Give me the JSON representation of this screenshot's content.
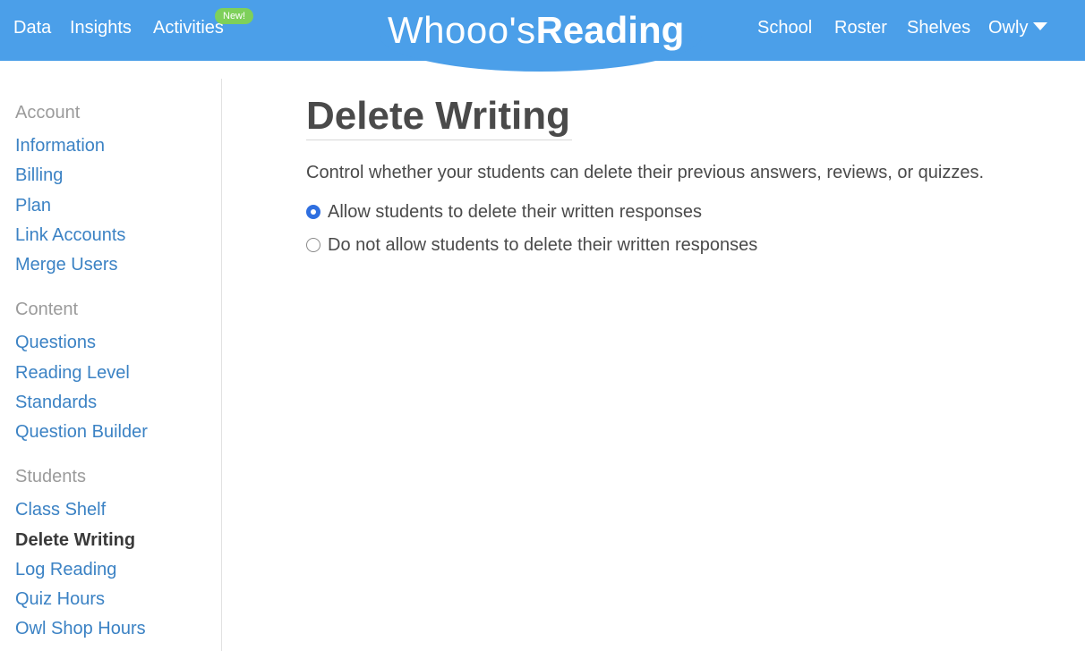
{
  "header": {
    "left_nav": [
      "Data",
      "Insights",
      "Activities"
    ],
    "new_badge": "New!",
    "logo": {
      "light": "Whooo's",
      "bold": "Reading"
    },
    "right_nav": [
      "School",
      "Roster",
      "Shelves"
    ],
    "user_menu": "Owly"
  },
  "sidebar": {
    "sections": [
      {
        "heading": "Account",
        "items": [
          "Information",
          "Billing",
          "Plan",
          "Link Accounts",
          "Merge Users"
        ]
      },
      {
        "heading": "Content",
        "items": [
          "Questions",
          "Reading Level",
          "Standards",
          "Question Builder"
        ]
      },
      {
        "heading": "Students",
        "items": [
          "Class Shelf",
          "Delete Writing",
          "Log Reading",
          "Quiz Hours",
          "Owl Shop Hours"
        ]
      }
    ],
    "active_item": "Delete Writing"
  },
  "main": {
    "title": "Delete Writing",
    "description": "Control whether your students can delete their previous answers, reviews, or quizzes.",
    "options": [
      {
        "label": "Allow students to delete their written responses",
        "selected": true
      },
      {
        "label": "Do not allow students to delete their written responses",
        "selected": false
      }
    ]
  },
  "colors": {
    "brand_blue": "#4b9fe9",
    "link_blue": "#3b82c4",
    "badge_green": "#7ed05a",
    "radio_blue": "#2f6fe0"
  }
}
